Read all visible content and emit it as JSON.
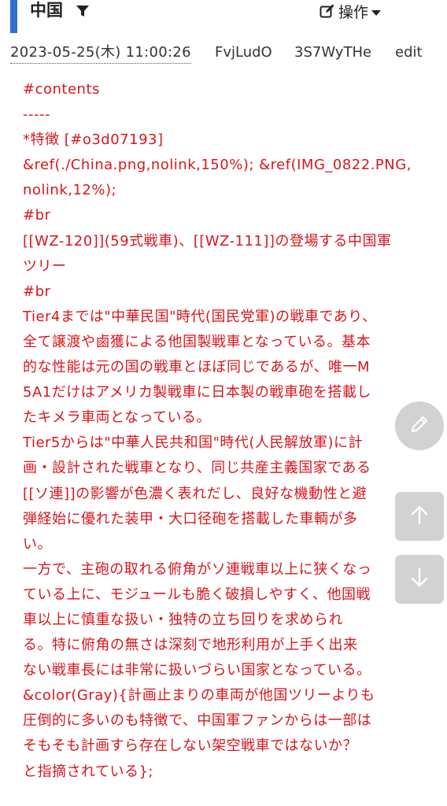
{
  "header": {
    "title": "中国",
    "filter_icon": "filter-icon",
    "menu_icon": "edit-icon",
    "menu_label": "操作",
    "menu_caret": "caret-down-icon",
    "accent_color": "#2f6fd0"
  },
  "meta": {
    "datetime": "2023-05-25(木) 11:00:26",
    "user_id_1": "FvjLudO",
    "user_id_2": "3S7WyTHe",
    "edit_link": "edit"
  },
  "content": {
    "text_color": "#d8161d",
    "lines": [
      "#contents",
      "-----",
      "*特徴 [#o3d07193]",
      "&ref(./China.png,nolink,150%); &ref(IMG_0822.PNG,",
      "nolink,12%);",
      "#br",
      "[[WZ-120]](59式戦車)、[[WZ-111]]の登場する中国軍",
      "ツリー",
      "#br",
      "Tier4までは\"中華民国\"時代(国民党軍)の戦車であり、",
      "全て譲渡や鹵獲による他国製戦車となっている。基本",
      "的な性能は元の国の戦車とほぼ同じであるが、唯一M",
      "5A1だけはアメリカ製戦車に日本製の戦車砲を搭載し",
      "たキメラ車両となっている。",
      "Tier5からは\"中華人民共和国\"時代(人民解放軍)に計",
      "画・設計された戦車となり、同じ共産主義国家である",
      "[[ソ連]]の影響が色濃く表れだし、良好な機動性と避",
      "弾経始に優れた装甲・大口径砲を搭載した車輌が多",
      "い。",
      "一方で、主砲の取れる俯角がソ連戦車以上に狭くなっ",
      "ている上に、モジュールも脆く破損しやすく、他国戦",
      "車以上に慎重な扱い・独特の立ち回りを求められ",
      "る。特に俯角の無さは深刻で地形利用が上手く出来",
      "ない戦車長には非常に扱いづらい国家となっている。",
      "&color(Gray){計画止まりの車両が他国ツリーよりも",
      "圧倒的に多いのも特徴で、中国軍ファンからは一部は",
      "そもそも計画すら存在しない架空戦車ではないか？",
      "と指摘されている};"
    ]
  },
  "floating_buttons": {
    "edit_icon": "pencil-icon",
    "up_icon": "arrow-up-icon",
    "down_icon": "arrow-down-icon"
  }
}
